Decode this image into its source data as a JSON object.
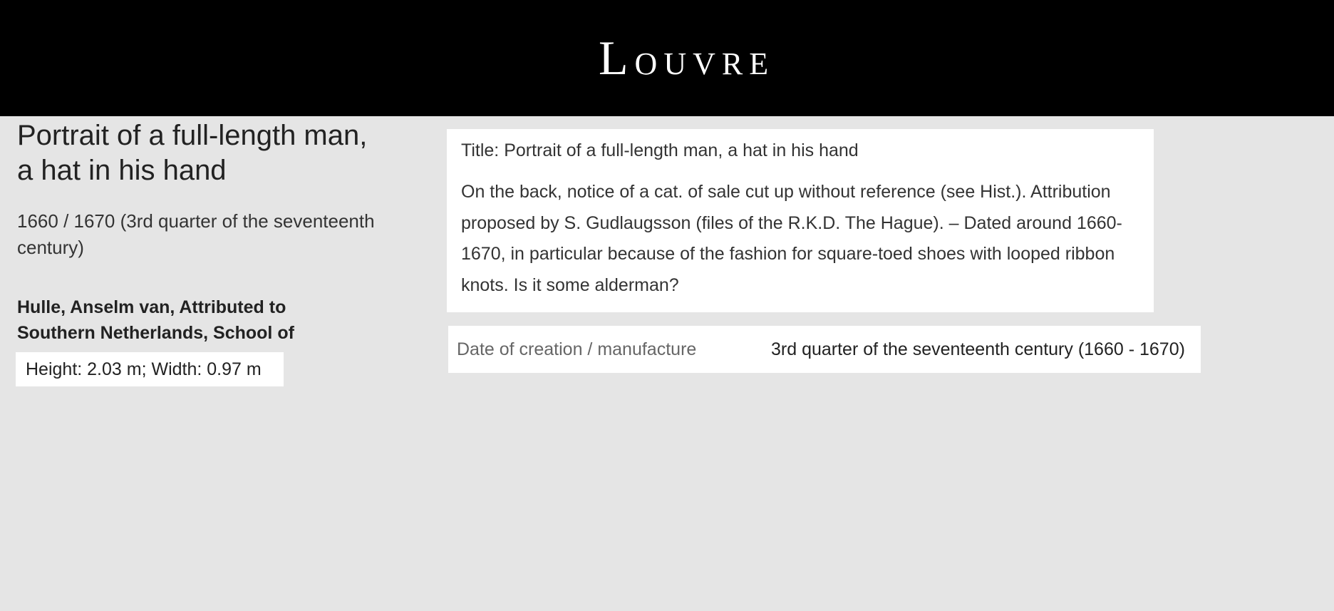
{
  "header": {
    "logo_first": "L",
    "logo_rest": "OUVRE"
  },
  "artwork": {
    "title": "Portrait of a full-length man, a hat in his hand",
    "dating": "1660 / 1670 (3rd quarter of the seventeenth century)",
    "artist_line1": "Hulle, Anselm van, Attributed to",
    "artist_line2": "Southern Netherlands, School of",
    "dimensions": "Height: 2.03 m; Width: 0.97 m"
  },
  "description": {
    "title_line": "Title: Portrait of a full-length man, a hat in his hand",
    "text": "On the back, notice of a cat. of sale cut up without reference (see Hist.). Attribution proposed by S. Gudlaugsson (files of the R.K.D. The Hague). – Dated around 1660-1670, in particular because of the fashion for square-toed shoes with looped ribbon knots. Is it some alderman?"
  },
  "details": {
    "date_label": "Date of creation / manufacture",
    "date_value": "3rd quarter of the seventeenth century (1660 - 1670)"
  }
}
